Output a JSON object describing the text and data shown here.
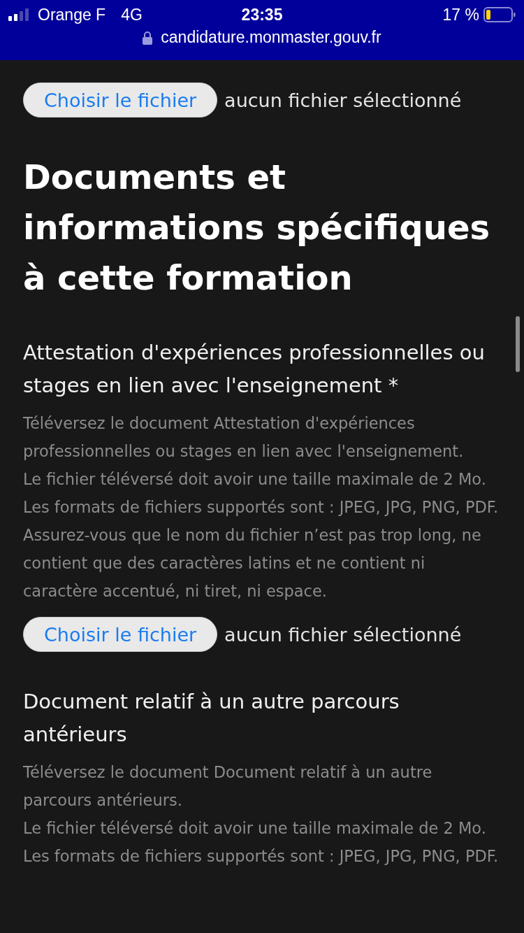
{
  "status_bar": {
    "carrier": "Orange F",
    "network": "4G",
    "time": "23:35",
    "battery": "17 %",
    "url": "candidature.monmaster.gouv.fr"
  },
  "top_upload": {
    "button": "Choisir le fichier",
    "status": "aucun fichier sélectionné"
  },
  "section_title": "Documents et informations spécifiques à cette formation",
  "documents": [
    {
      "title": "Attestation d'expériences professionnelles ou stages en lien avec l'enseignement *",
      "help": [
        "Téléversez le document Attestation d'expériences professionnelles ou stages en lien avec l'enseignement.",
        "Le fichier téléversé doit avoir une taille maximale de 2 Mo.",
        "Les formats de fichiers supportés sont : JPEG, JPG, PNG, PDF.",
        "Assurez-vous que le nom du fichier n’est pas trop long, ne contient que des caractères latins et ne contient ni caractère accentué, ni tiret, ni espace."
      ],
      "upload": {
        "button": "Choisir le fichier",
        "status": "aucun fichier sélectionné"
      }
    },
    {
      "title": "Document relatif à un autre parcours antérieurs",
      "help": [
        "Téléversez le document Document relatif à un autre parcours antérieurs.",
        "Le fichier téléversé doit avoir une taille maximale de 2 Mo.",
        "Les formats de fichiers supportés sont : JPEG, JPG, PNG, PDF."
      ]
    }
  ]
}
